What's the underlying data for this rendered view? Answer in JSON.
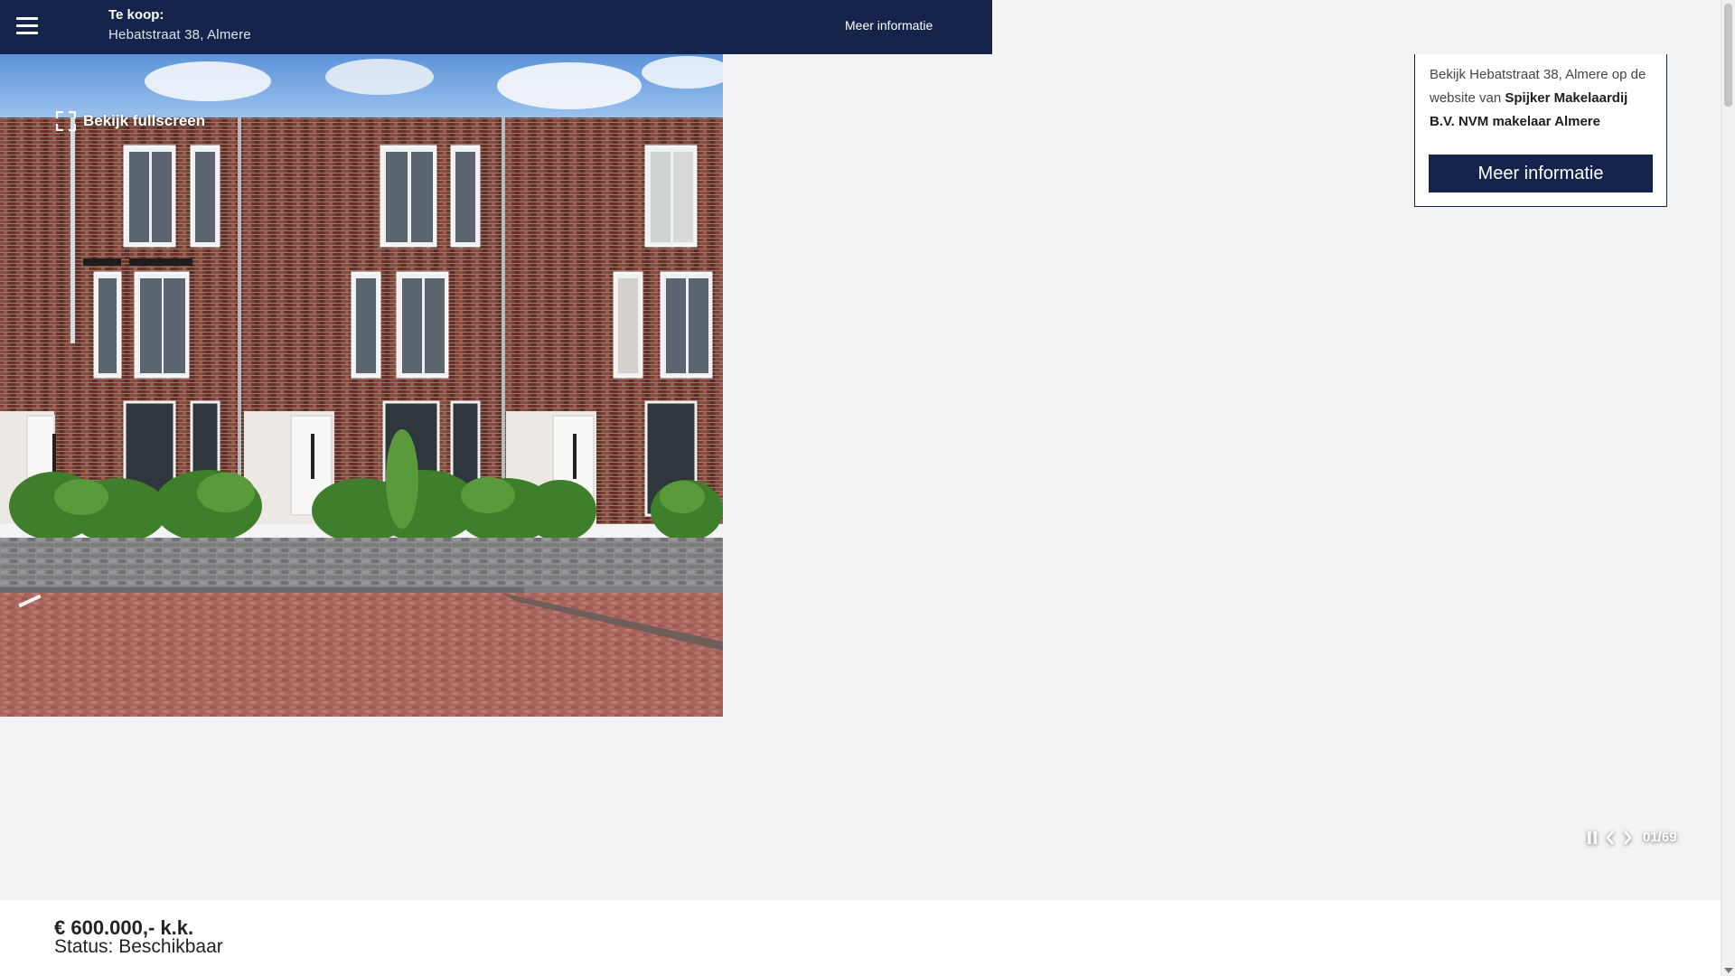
{
  "header": {
    "label": "Te koop:",
    "address": "Hebatstraat 38, Almere",
    "more_link": "Meer informatie",
    "menu_icon": "hamburger-menu-icon"
  },
  "gallery": {
    "fullscreen_label": "Bekijk fullscreen",
    "fullscreen_icon": "fullscreen-icon",
    "counter": "01/69",
    "pause_icon": "pause-icon",
    "prev_icon": "chevron-left-icon",
    "next_icon": "chevron-right-icon"
  },
  "info_card": {
    "text_prefix": "Bekijk Hebatstraat 38, Almere op de website van ",
    "agency": "Spijker Makelaardij B.V. NVM makelaar Almere",
    "button_label": "Meer informatie"
  },
  "listing": {
    "price": "€ 600.000,- k.k.",
    "status": "Status: Beschikbaar"
  },
  "colors": {
    "brand_navy": "#14244a",
    "page_bg": "#f3f3f6"
  }
}
